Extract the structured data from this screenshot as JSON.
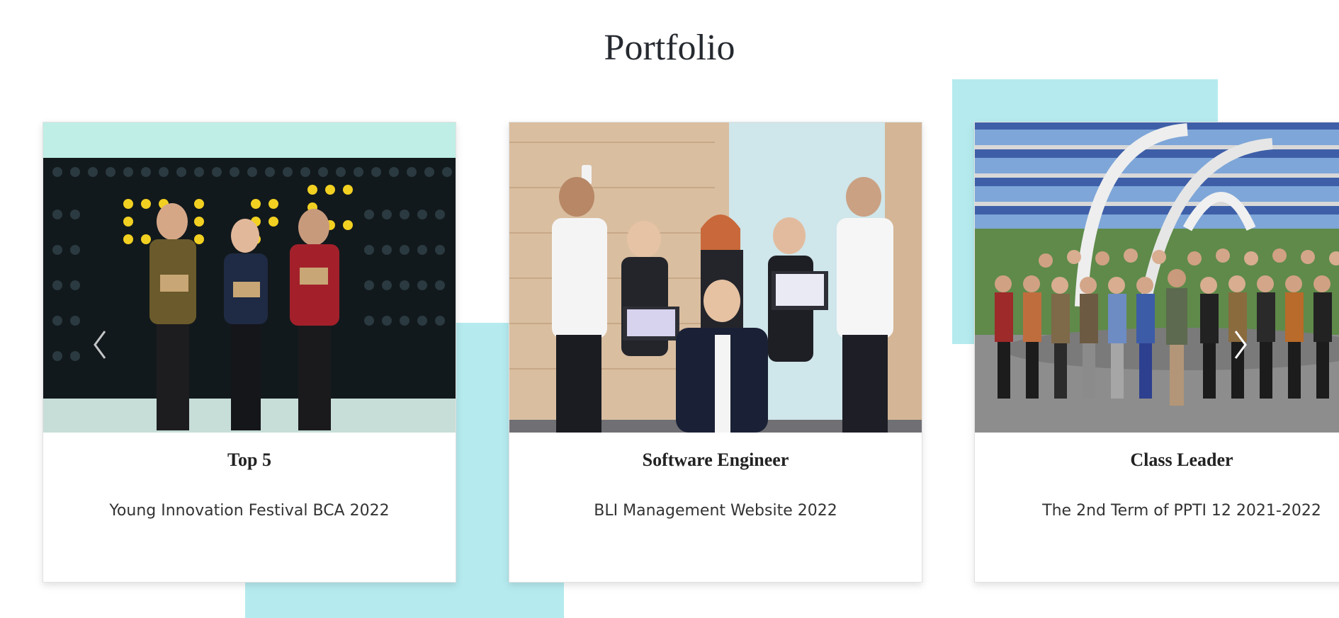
{
  "section": {
    "title": "Portfolio"
  },
  "carousel": {
    "prev_icon": "chevron-left-icon",
    "next_icon": "chevron-right-icon",
    "items": [
      {
        "title": "Top 5",
        "subtitle": "Young Innovation Festival BCA 2022"
      },
      {
        "title": "Software Engineer",
        "subtitle": "BLI Management Website 2022"
      },
      {
        "title": "Class Leader",
        "subtitle": "The 2nd Term of PPTI 12 2021-2022"
      }
    ]
  },
  "colors": {
    "accent": "#b5ebef",
    "title_text": "#262a30"
  }
}
